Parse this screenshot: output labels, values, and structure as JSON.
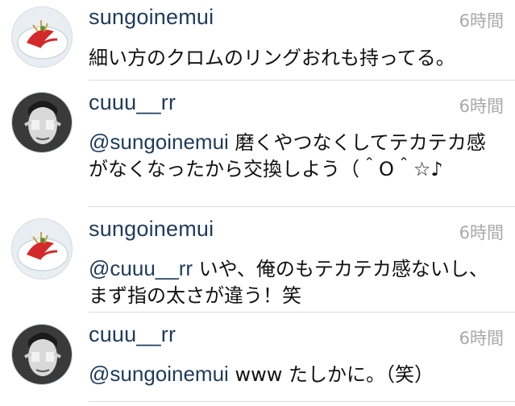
{
  "comments": [
    {
      "username": "sungoinemui",
      "timestamp": "6時間",
      "mention": "",
      "text": "細い方のクロムのリングおれも持ってる。",
      "avatar": "sungoinemui-avatar-icon"
    },
    {
      "username": "cuuu__rr",
      "timestamp": "6時間",
      "mention": "@sungoinemui",
      "text": "  磨くやつなくしてテカテカ感がなくなったから交換しよう（＾O＾☆♪",
      "avatar": "cuuu-rr-avatar-icon"
    },
    {
      "username": "sungoinemui",
      "timestamp": "6時間",
      "mention": "@cuuu__rr",
      "text": " いや、俺のもテカテカ感ないし、まず指の太さが違う！笑",
      "avatar": "sungoinemui-avatar-icon"
    },
    {
      "username": "cuuu__rr",
      "timestamp": "6時間",
      "mention": "@sungoinemui",
      "text": " www  たしかに。（笑）",
      "avatar": "cuuu-rr-avatar-icon"
    }
  ],
  "colors": {
    "username": "#1f3b5a",
    "timestamp": "#a9a9a9",
    "divider": "#dadada",
    "text": "#111111"
  }
}
